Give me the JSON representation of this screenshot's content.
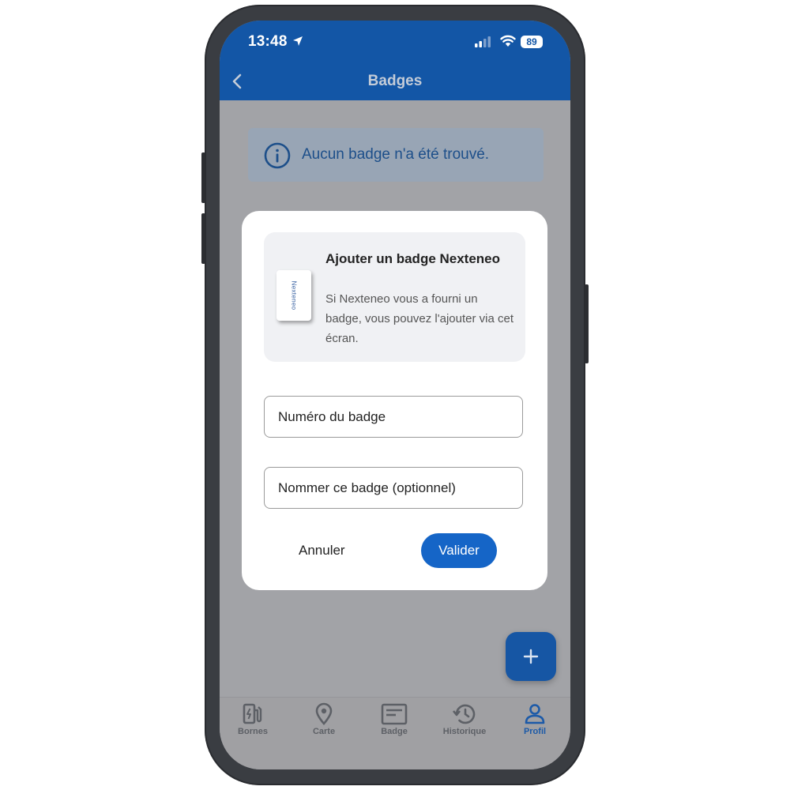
{
  "status_bar": {
    "time": "13:48",
    "battery": "89"
  },
  "header": {
    "title": "Badges"
  },
  "info_banner": {
    "text": "Aucun badge n'a été trouvé."
  },
  "modal": {
    "card_title": "Ajouter un badge Nexteneo",
    "card_description": "Si Nexteneo vous a fourni un badge, vous pouvez l'ajouter via cet écran.",
    "badge_brand": "Nexteneo",
    "badge_number_placeholder": "Numéro du badge",
    "badge_name_placeholder": "Nommer ce badge (optionnel)",
    "cancel_label": "Annuler",
    "validate_label": "Valider"
  },
  "fab": {
    "icon": "plus-icon"
  },
  "bottom_nav": {
    "items": [
      {
        "label": "Bornes",
        "icon": "charging-station-icon"
      },
      {
        "label": "Carte",
        "icon": "map-pin-icon"
      },
      {
        "label": "Badge",
        "icon": "badge-card-icon"
      },
      {
        "label": "Historique",
        "icon": "history-icon"
      },
      {
        "label": "Profil",
        "icon": "user-icon"
      }
    ],
    "active": "Profil"
  },
  "colors": {
    "header": "#1356a6",
    "accent": "#1565c7",
    "overlay_bg": "#a2a3a7",
    "frame": "#3a3d42"
  }
}
